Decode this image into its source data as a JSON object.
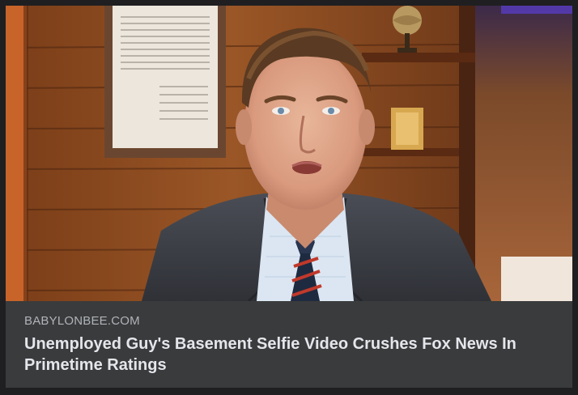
{
  "link_preview": {
    "source": "BABYLONBEE.COM",
    "headline": "Unemployed Guy's Basement Selfie Video Crushes Fox News In Primetime Ratings"
  },
  "colors": {
    "page_background": "#1f1f21",
    "card_background": "#3a3b3c",
    "source_text": "#b0b3b8",
    "headline_text": "#e4e6eb"
  }
}
